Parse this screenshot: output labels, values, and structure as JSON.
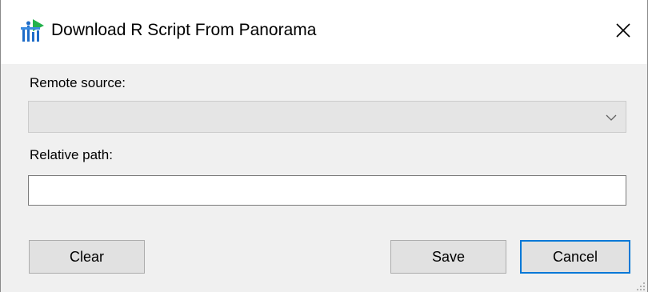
{
  "window": {
    "title": "Download R Script From Panorama",
    "icons": {
      "app": "panorama-app-icon",
      "close": "close-icon",
      "dropdown": "chevron-down-icon",
      "grip": "size-grip-icon"
    },
    "colors": {
      "accent": "#0078d7",
      "client_bg": "#f0f0f0",
      "title_bg": "#ffffff",
      "disabled_combo_bg": "#e5e5e5",
      "icon_green": "#22b14c",
      "icon_blue": "#1e6cc8"
    }
  },
  "form": {
    "remote_source_label": "Remote source:",
    "remote_source_value": "",
    "relative_path_label": "Relative path:",
    "relative_path_value": ""
  },
  "buttons": {
    "clear": "Clear",
    "save": "Save",
    "cancel": "Cancel"
  }
}
